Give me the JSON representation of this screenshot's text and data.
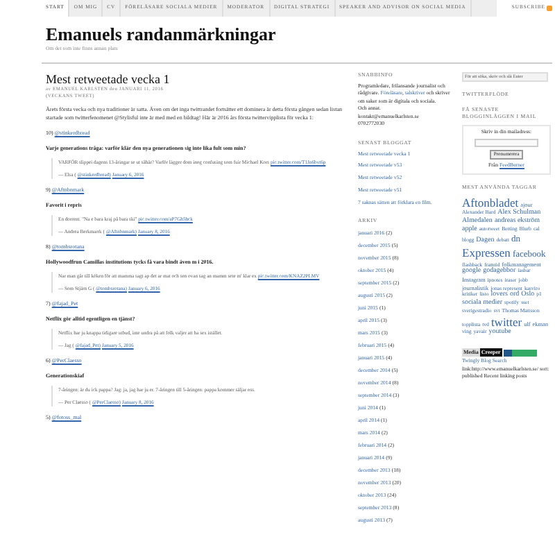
{
  "nav": {
    "items": [
      {
        "label": "START",
        "selected": true
      },
      {
        "label": "OM MIG",
        "selected": false
      },
      {
        "label": "CV",
        "selected": false
      },
      {
        "label": "FÖRELÄSARE SOCIALA MEDIER",
        "selected": false
      },
      {
        "label": "MODERATOR",
        "selected": false
      },
      {
        "label": "DIGITAL STRATEGI",
        "selected": false
      },
      {
        "label": "SPEAKER AND ADVISOR ON SOCIAL MEDIA",
        "selected": false
      }
    ],
    "subscribe": "SUBSCRIBE"
  },
  "header": {
    "title": "Emanuels randanmärkningar",
    "tagline": "Om det som inte finns annan plats"
  },
  "post": {
    "title": "Mest retweetade vecka 1",
    "meta": [
      "av EMANUEL KARLSTEN den JANUARI 11, 2016",
      "(VECKANS TWEET)"
    ],
    "intro": "Årets första vecka och nya traditioner är satta. Även om det inga twittrandet fortsätter ett dominera är detta första gången sedan listan startade som twitterfenomenet @Stylisful inte är med med en bildtag! Här är 2016 års första twittervipplista för vecka 1:",
    "entries": [
      {
        "rank": "10)",
        "handle": "@stinkerdbread",
        "comment": "Varje generations tråga: varför klär den nya generationen sig inte lika fult som min?",
        "quote": "VARFÖR slippei dagens 13-åringar se ut såhär? Varför lägger dom inog confusing som fuir Michael Kors",
        "link": "pic.twitter.com/T1Jn6bvt6p",
        "author": "— Elsa (",
        "author_handle": "@stinkerdbread)",
        "date": "January 6, 2016"
      },
      {
        "rank": "9)",
        "handle": "@Aftnbnmark",
        "comment": "Favorit i repris",
        "quote": "En dorrent. \"Na e bara kraj på bara ski\"",
        "link": "pic.twitter.com/aP7Gh5hck",
        "author": "— Andrea Berkmarrk (",
        "author_handle": "@Aftnbnmark)",
        "date": "January 8, 2016"
      },
      {
        "rank": "8)",
        "handle": "@tombsrotana",
        "comment": "Hollywoodfrun Camillas institutions tycks få vara bindt även m i 2016.",
        "quote": "Nar man går till köken för att mamma sagt ap det ar mat och sen ovan sag an mamm sete m' klar ex",
        "link": "pic.twitter.com/KNAZ2PLMV",
        "author": "— Som Stjärn G (",
        "author_handle": "@tombsrotana)",
        "date": "January 6, 2016"
      },
      {
        "rank": "7)",
        "handle": "@fajad_Pet",
        "comment": "Netflix gör alltid egentligen en tjänst?",
        "quote": "Netflix har ju knappa tidigare utbud, inte undra på att folk valjer att ha sex istället.",
        "author": "— Jag (",
        "author_handle": "@fajad_Pet)",
        "date": "January 5, 2016"
      },
      {
        "rank": "6)",
        "handle": "@PerClaesso",
        "comment": "Generationskiaf",
        "quote": "7-åringen: är du ick pappa? Jag: ja, jag har ju er. 7-åringen till 5-åringen: pappa kommer säljar oss.",
        "author": "— Per Claesso (",
        "author_handle": "@PerClaesso)",
        "date": "January 8, 2016"
      },
      {
        "rank": "5)",
        "handle": "@fotoss_mal"
      }
    ]
  },
  "sidebar": {
    "info_heading": "SNABBINFO",
    "info_text": "Programledare, frilansande journalist och rådgivare. ",
    "info_links": [
      "Föreläsare",
      "talskriver"
    ],
    "info_sep": ", ",
    "info_text2": " och skriver om saker som är digitala och sociala.",
    "info_more": "Och annat.",
    "email": "kontakt@emanuelkarlsten.se",
    "phone": "0702772030",
    "recent_heading": "SENAST BLOGGAT",
    "recent": [
      "Mest retweetade vecka 1",
      "Mest retweetade v53",
      "Mest retweetade v52",
      "Mest retweetade v51",
      "7 saknas sätten att förklara en film."
    ],
    "archive_heading": "ARKIV",
    "archive": [
      {
        "month": "januari 2016",
        "count": "(2)"
      },
      {
        "month": "december 2015",
        "count": "(5)"
      },
      {
        "month": "november 2015",
        "count": "(8)"
      },
      {
        "month": "oktober 2015",
        "count": "(4)"
      },
      {
        "month": "september 2015",
        "count": "(2)"
      },
      {
        "month": "augusti 2015",
        "count": "(2)"
      },
      {
        "month": "juni 2015",
        "count": "(1)"
      },
      {
        "month": "april 2015",
        "count": "(3)"
      },
      {
        "month": "mars 2015",
        "count": "(3)"
      },
      {
        "month": "februari 2015",
        "count": "(4)"
      },
      {
        "month": "januari 2015",
        "count": "(4)"
      },
      {
        "month": "december 2014",
        "count": "(5)"
      },
      {
        "month": "november 2014",
        "count": "(8)"
      },
      {
        "month": "september 2014",
        "count": "(3)"
      },
      {
        "month": "juni 2014",
        "count": "(1)"
      },
      {
        "month": "april 2014",
        "count": "(1)"
      },
      {
        "month": "mars 2014",
        "count": "(2)"
      },
      {
        "month": "februari 2014",
        "count": "(2)"
      },
      {
        "month": "januari 2014",
        "count": "(9)"
      },
      {
        "month": "december 2013",
        "count": "(18)"
      },
      {
        "month": "november 2013",
        "count": "(20)"
      },
      {
        "month": "oktober 2013",
        "count": "(24)"
      },
      {
        "month": "september 2013",
        "count": "(8)"
      },
      {
        "month": "augusti 2013",
        "count": "(7)"
      }
    ]
  },
  "sidebar2": {
    "search_placeholder": "För att söka, skriv och slå Enter",
    "twitter_heading": "TWITTERFLÖDE",
    "mail_heading": "FÅ SENASTE BLOGGINLÄGGEN I MAIL",
    "mail_label": "Skriv in din mailadress:",
    "mail_button": "Prenumerera",
    "mail_from": "Från ",
    "mail_link": "FeedBurner",
    "tags_heading": "MEST ANVÄNDA TAGGAR",
    "tags": [
      {
        "label": "Aftonbladet",
        "kind": "xl"
      },
      {
        "label": "ajour",
        "kind": "s"
      },
      {
        "label": "Alexander Bard",
        "kind": "xs"
      },
      {
        "label": "Alex Schulman",
        "kind": "m"
      },
      {
        "label": "Almedalen",
        "kind": "m"
      },
      {
        "label": "andreas ekström",
        "kind": "m"
      },
      {
        "label": "apple",
        "kind": "m"
      },
      {
        "label": "autotweet",
        "kind": "xs"
      },
      {
        "label": "Betting",
        "kind": "xs"
      },
      {
        "label": "Blurb",
        "kind": "xs"
      },
      {
        "label": "cal",
        "kind": "xs"
      },
      {
        "label": "blogg",
        "kind": "xs"
      },
      {
        "label": "Dagen",
        "kind": "m"
      },
      {
        "label": "debatt",
        "kind": "xs"
      },
      {
        "label": "dn",
        "kind": "l"
      },
      {
        "label": "Expressen",
        "kind": "xl"
      },
      {
        "label": "facebook",
        "kind": "l"
      },
      {
        "label": "flashback",
        "kind": "xs"
      },
      {
        "label": "framtid",
        "kind": "xs"
      },
      {
        "label": "folkmanagement",
        "kind": "s"
      },
      {
        "label": "google",
        "kind": "m"
      },
      {
        "label": "godagebbor",
        "kind": "m"
      },
      {
        "label": "iasbar",
        "kind": "xs"
      },
      {
        "label": "Instagram",
        "kind": "s"
      },
      {
        "label": "ipnotes",
        "kind": "xs"
      },
      {
        "label": "iraser",
        "kind": "xs"
      },
      {
        "label": "jobb",
        "kind": "xs"
      },
      {
        "label": "journalistik",
        "kind": "s"
      },
      {
        "label": "jonas represent",
        "kind": "xs"
      },
      {
        "label": "kasviro",
        "kind": "xs"
      },
      {
        "label": "kritiker",
        "kind": "xs"
      },
      {
        "label": "listo",
        "kind": "xs"
      },
      {
        "label": "lovers",
        "kind": "m"
      },
      {
        "label": "ord",
        "kind": "m"
      },
      {
        "label": "Oslo",
        "kind": "m"
      },
      {
        "label": "p1",
        "kind": "xs"
      },
      {
        "label": "sociala medier",
        "kind": "m"
      },
      {
        "label": "spotify",
        "kind": "xs"
      },
      {
        "label": "sset",
        "kind": "xs"
      },
      {
        "label": "sverigestradio",
        "kind": "xs"
      },
      {
        "label": "svt",
        "kind": "xs"
      },
      {
        "label": "Thomas Mattsson",
        "kind": "xs"
      },
      {
        "label": "topplista",
        "kind": "xs"
      },
      {
        "label": "tvd",
        "kind": "xs"
      },
      {
        "label": "twitter",
        "kind": "xl"
      },
      {
        "label": "ulf",
        "kind": "s"
      },
      {
        "label": "ekman",
        "kind": "s"
      },
      {
        "label": "ving",
        "kind": "xs"
      },
      {
        "label": "yavair",
        "kind": "xs"
      },
      {
        "label": "youtube",
        "kind": "m"
      }
    ],
    "badges": [
      "Media",
      "Creeper"
    ],
    "twingly": "Twingly Blog Search",
    "twingly_text": "link:http://www.emanuelkarlsten.se/ sort:published Recent linking posts"
  }
}
